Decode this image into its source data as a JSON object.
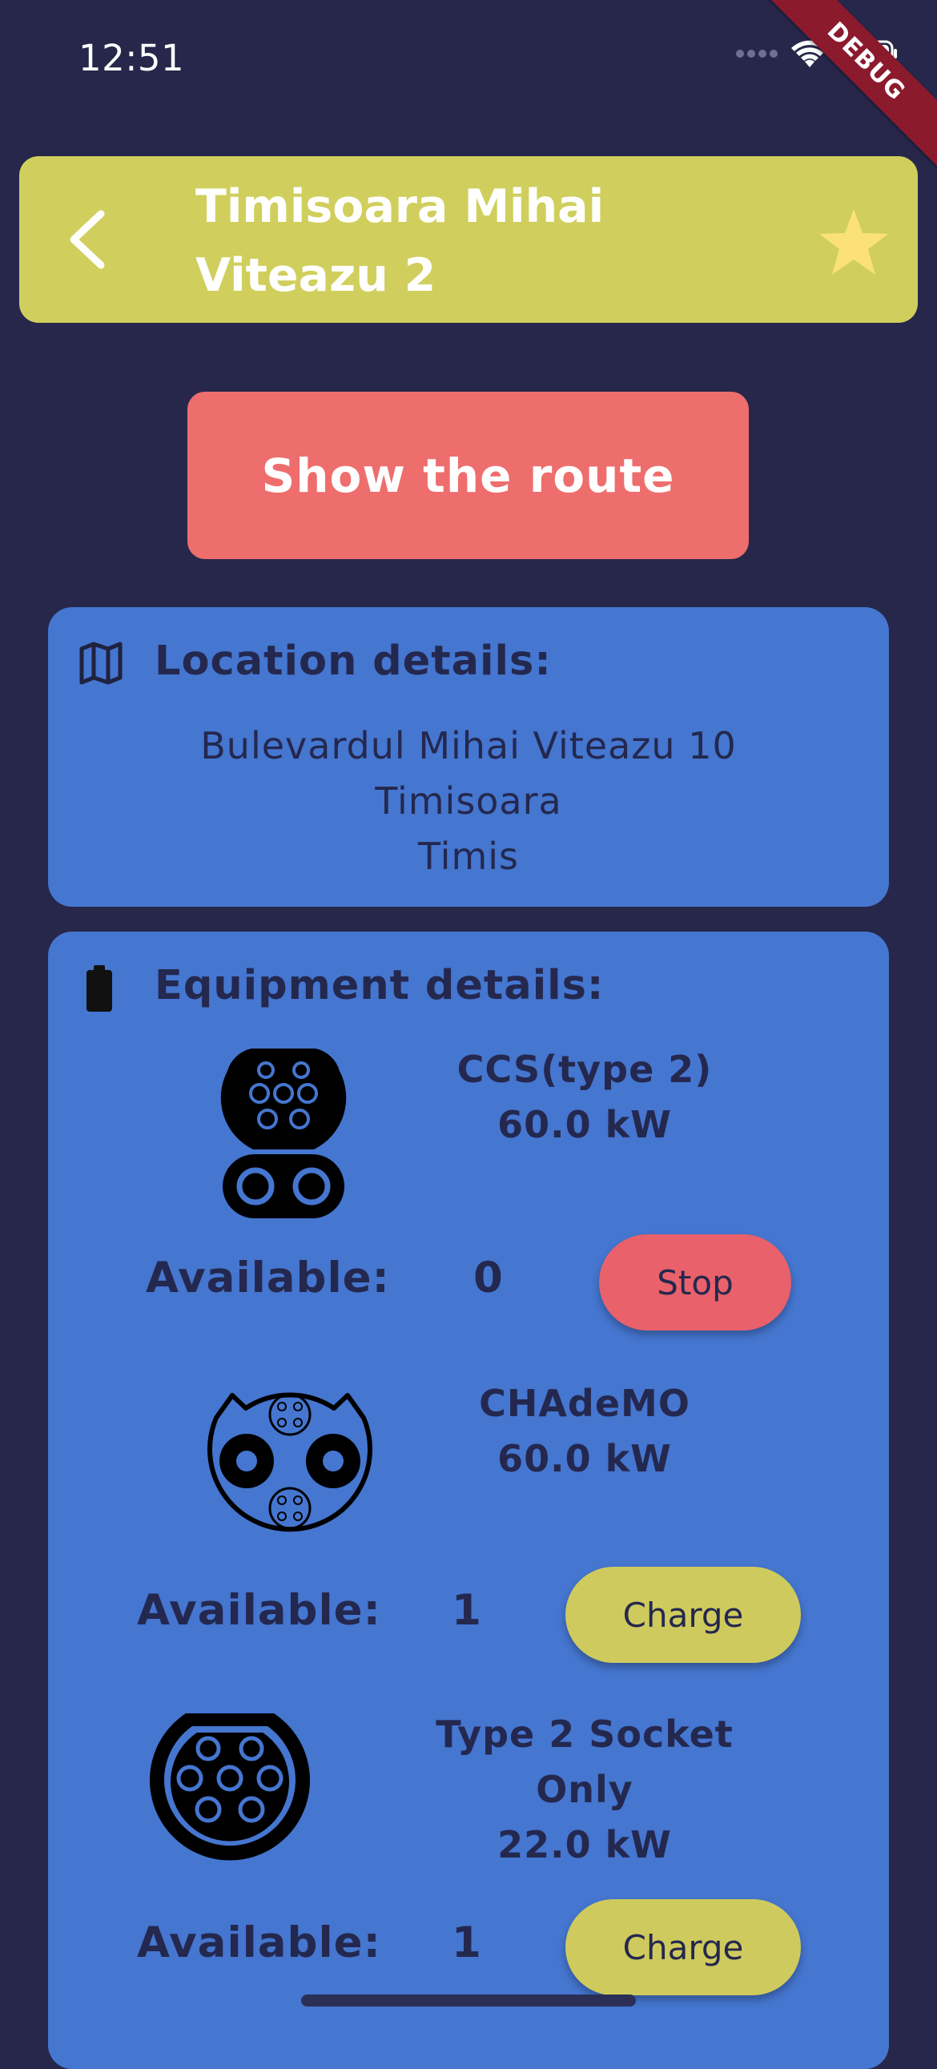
{
  "status_bar": {
    "time": "12:51",
    "icons": [
      "signal-icon",
      "wifi-icon",
      "battery-icon"
    ]
  },
  "debug_banner": "DEBUG",
  "header": {
    "title_line1": "Timisoara Mihai",
    "title_line2": "Viteazu 2",
    "back_icon": "chevron-left-icon",
    "favorite_icon": "star-icon",
    "background": "#d0cf5d"
  },
  "route_button": {
    "label": "Show the route",
    "color": "#ee6e6d"
  },
  "location": {
    "title": "Location details:",
    "icon": "map-icon",
    "address_line1": "Bulevardul Mihai Viteazu 10",
    "city": "Timisoara",
    "county": "Timis"
  },
  "equipment": {
    "title": "Equipment details:",
    "icon": "battery-icon",
    "connectors": [
      {
        "type": "CCS(type 2)",
        "power": "60.0 kW",
        "available_label": "Available:",
        "available": "0",
        "action": "Stop",
        "action_color": "#e9616a",
        "icon": "ccs-connector-icon"
      },
      {
        "type": "CHAdeMO",
        "power": "60.0 kW",
        "available_label": "Available:",
        "available": "1",
        "action": "Charge",
        "action_color": "#cfca5d",
        "icon": "chademo-connector-icon"
      },
      {
        "type": "Type 2 Socket Only",
        "power": "22.0 kW",
        "available_label": "Available:",
        "available": "1",
        "action": "Charge",
        "action_color": "#cfca5d",
        "icon": "type2-connector-icon"
      }
    ]
  },
  "colors": {
    "background": "#26274a",
    "card": "#4576d0",
    "card_text": "#24284e"
  }
}
